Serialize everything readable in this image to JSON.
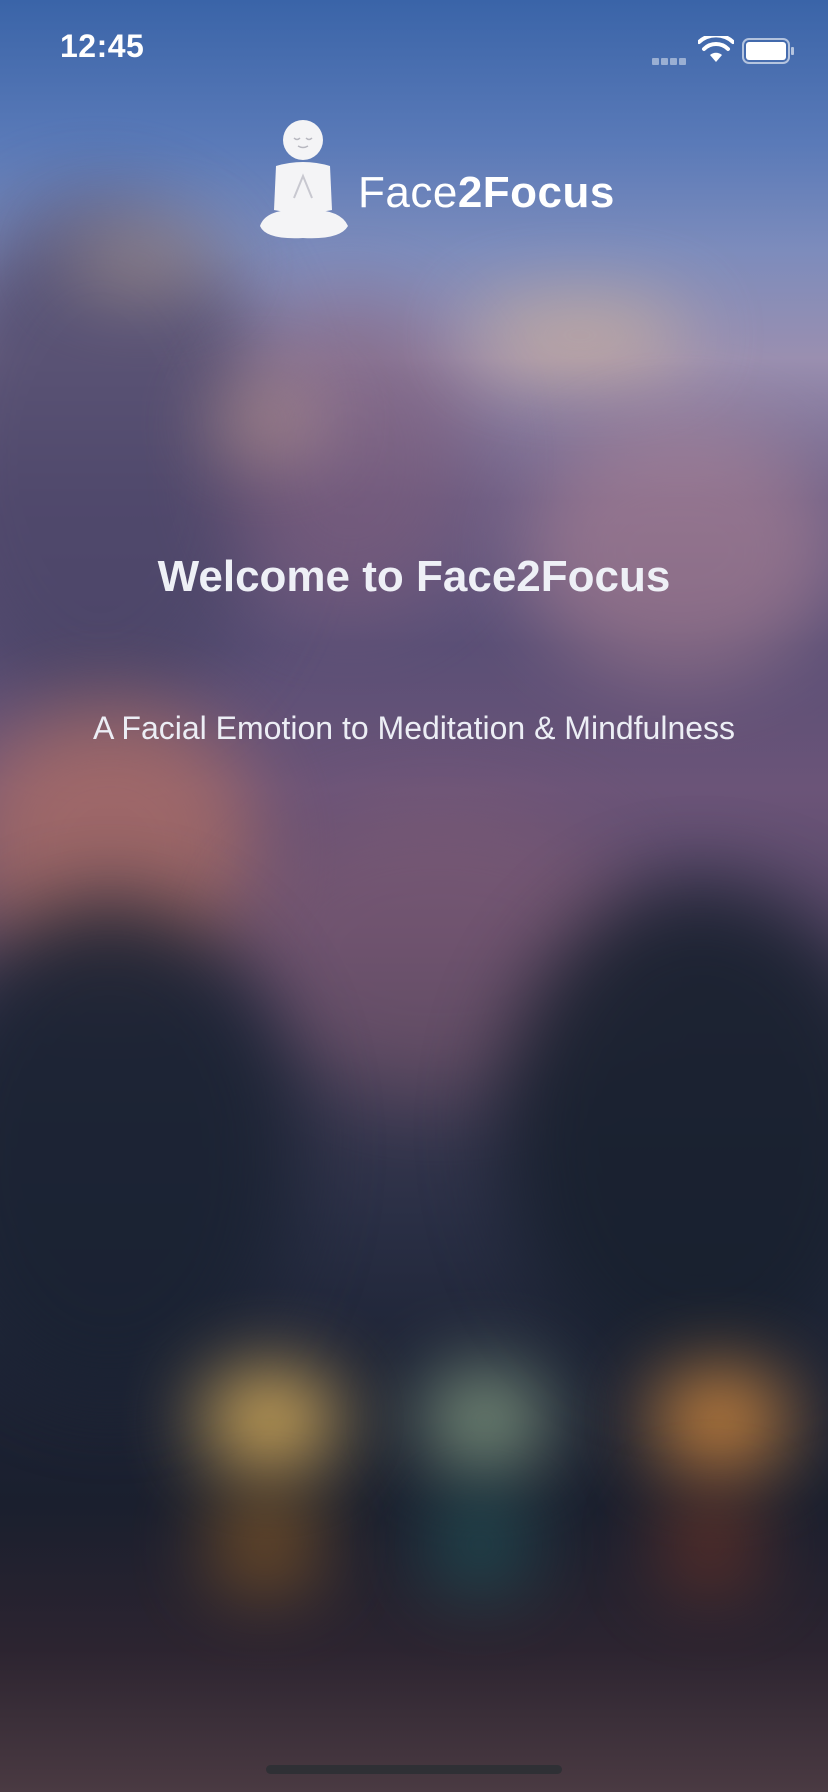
{
  "status_bar": {
    "time": "12:45",
    "signal_icon": "cellular-signal-icon",
    "wifi_icon": "wifi-icon",
    "battery_icon": "battery-icon"
  },
  "logo": {
    "icon": "meditating-person-icon",
    "text_light": "Face",
    "text_bold": "2Focus"
  },
  "welcome": {
    "title": "Welcome to Face2Focus",
    "subtitle": "A Facial Emotion to Meditation & Mindfulness"
  },
  "colors": {
    "text": "#ffffff",
    "sky_top": "#3a64a8",
    "home_indicator": "#2f3035"
  }
}
